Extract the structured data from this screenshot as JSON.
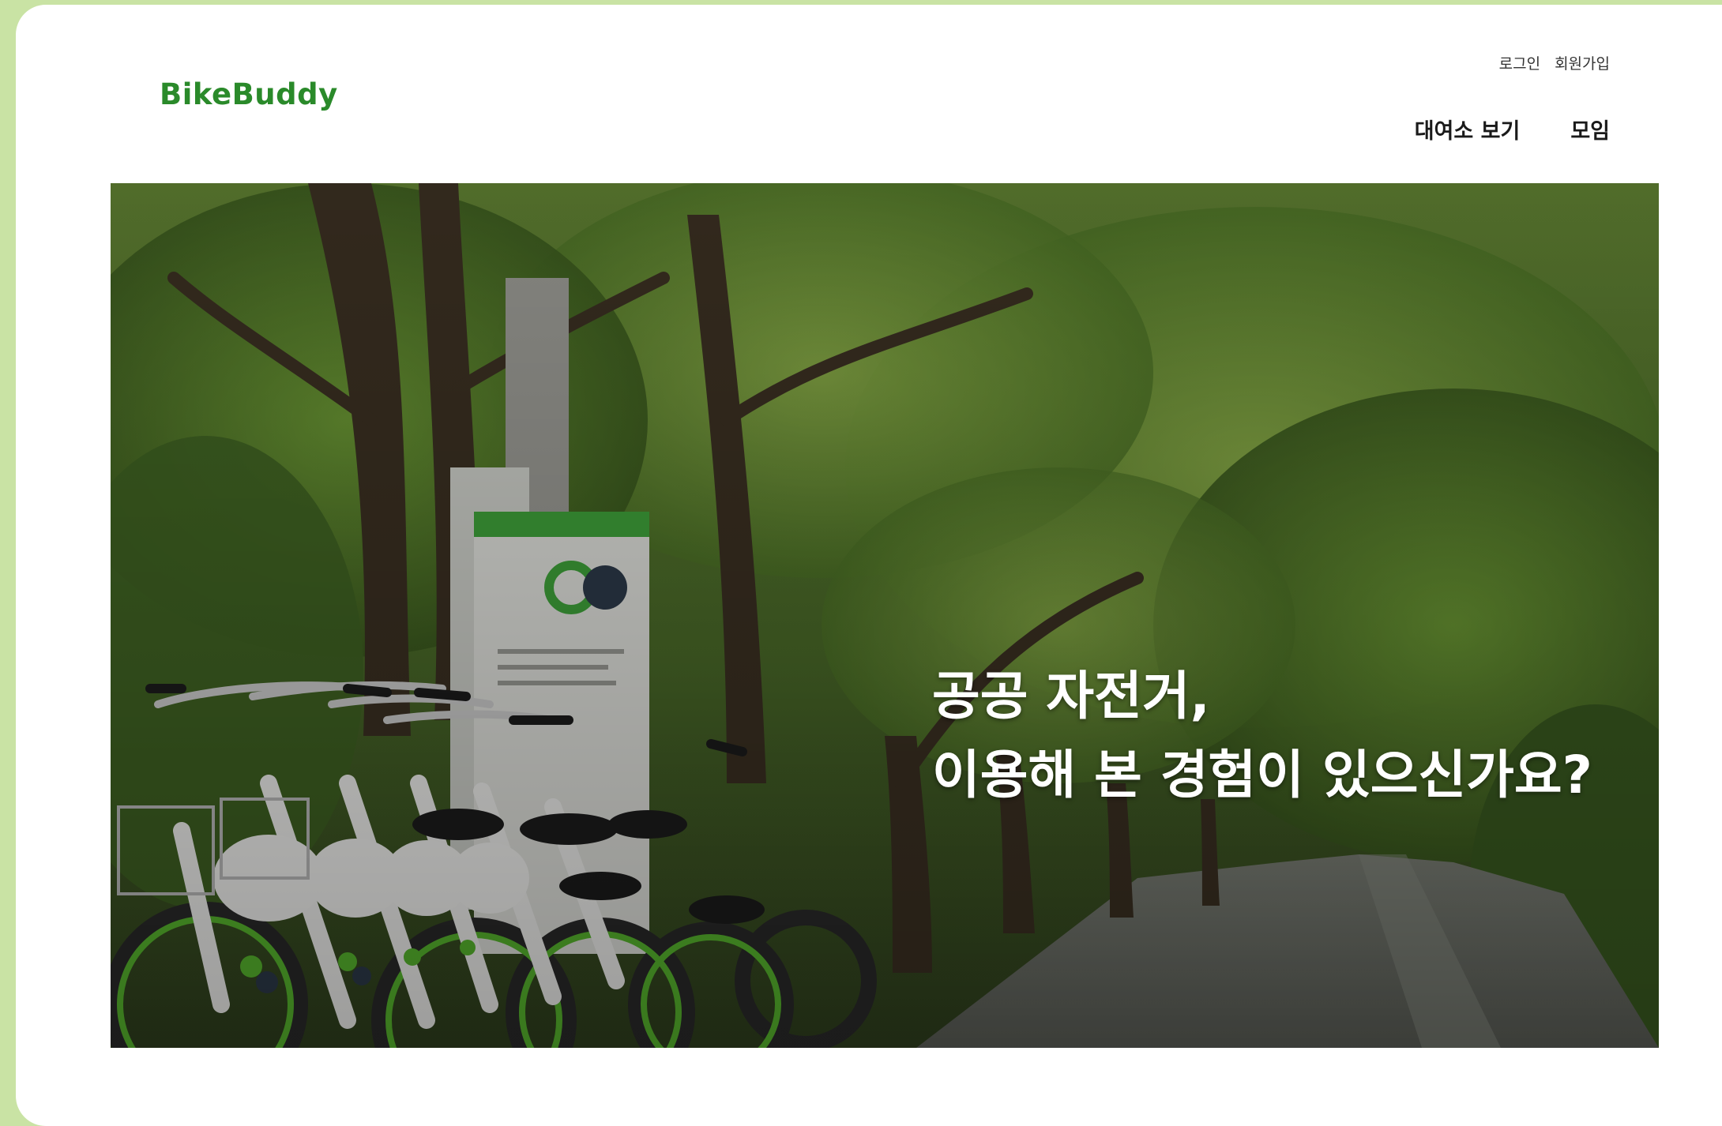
{
  "header": {
    "logo": "BikeBuddy",
    "auth": {
      "login": "로그인",
      "signup": "회원가입"
    },
    "nav": [
      {
        "label": "대여소 보기"
      },
      {
        "label": "모임"
      }
    ]
  },
  "hero": {
    "line1": "공공 자전거,",
    "line2": "이용해 본 경험이 있으신가요?"
  },
  "colors": {
    "brand": "#2a8a2a",
    "page_background": "#c9e3a4"
  }
}
